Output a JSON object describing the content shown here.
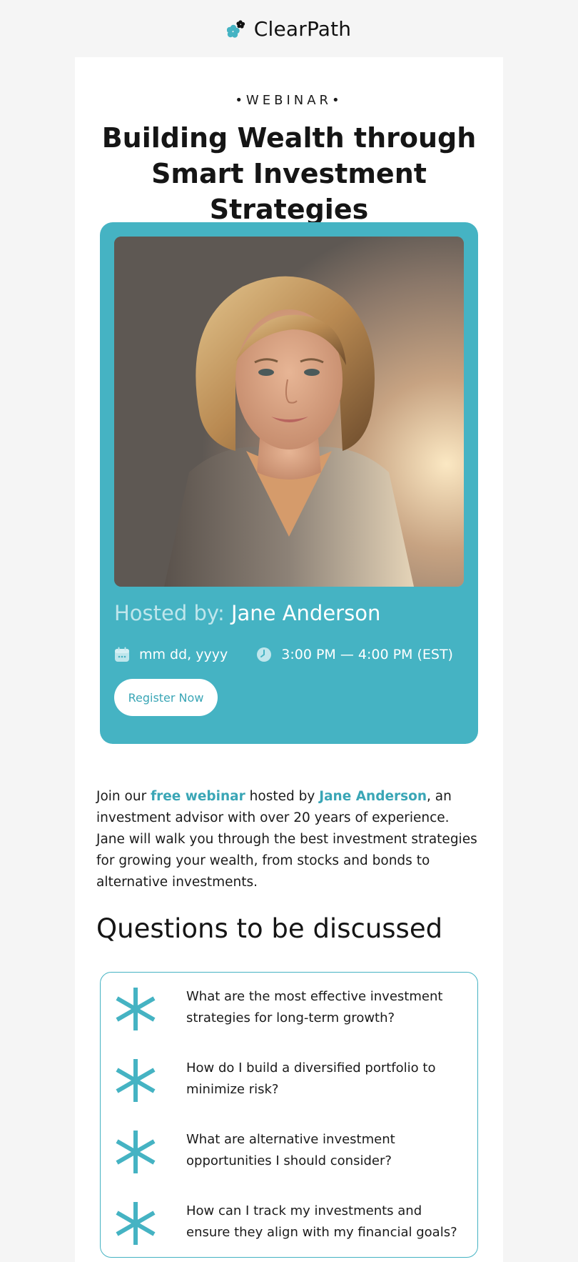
{
  "brand": {
    "name": "ClearPath",
    "accent_color": "#45b3c3",
    "logo_icon": "clearpath-flower-logo"
  },
  "hero": {
    "eyebrow": "•WEBINAR•",
    "title": "Building Wealth through Smart Investment Strategies"
  },
  "host": {
    "hosted_label": "Hosted by:",
    "name": "Jane Anderson",
    "date": "mm dd, yyyy",
    "date_icon": "calendar-icon",
    "time": "3:00 PM — 4:00 PM (EST)",
    "time_icon": "clock-icon",
    "register_label": "Register Now"
  },
  "intro": {
    "part1": "Join our ",
    "link1": "free webinar",
    "part2": " hosted by ",
    "link2": "Jane Anderson",
    "part3": ", an investment advisor with over 20 years of experience. Jane will walk you through the best investment strategies for growing your wealth, from stocks and bonds to alternative investments."
  },
  "questions": {
    "title": "Questions to be discussed",
    "bullet_icon": "asterisk-icon",
    "items": [
      "What are the most effective investment strategies for long-term growth?",
      "How do I build a diversified portfolio to minimize risk?",
      "What are alternative investment opportunities I should consider?",
      "How can I track my investments and ensure they align with my financial goals?"
    ]
  }
}
